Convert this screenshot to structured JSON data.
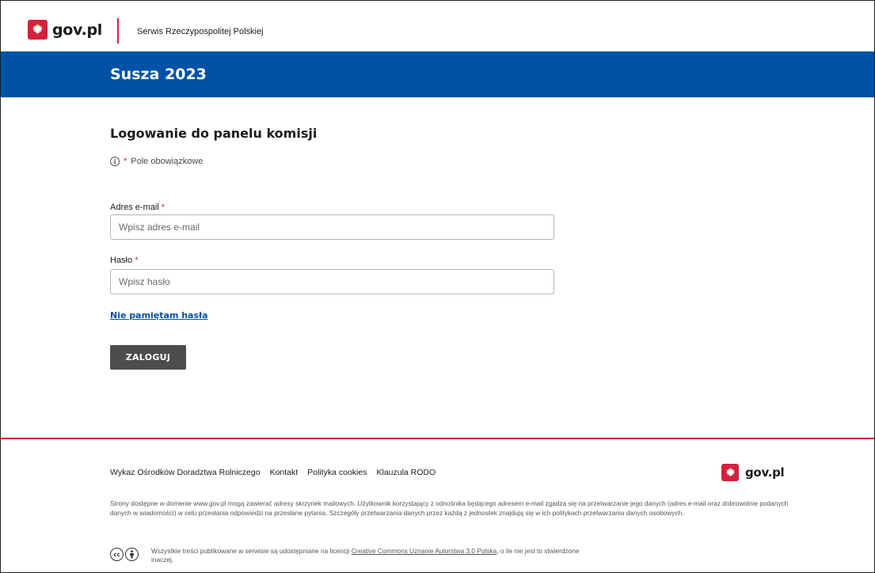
{
  "header": {
    "logo_text": "gov.pl",
    "service_name": "Serwis Rzeczypospolitej Polskiej"
  },
  "banner": {
    "title": "Susza 2023"
  },
  "main": {
    "title": "Logowanie do panelu komisji",
    "required_marker": "*",
    "required_note": "Pole obowiązkowe",
    "email": {
      "label": "Adres e-mail",
      "placeholder": "Wpisz adres e-mail",
      "value": ""
    },
    "password": {
      "label": "Hasło",
      "placeholder": "Wpisz hasło",
      "value": ""
    },
    "forgot_link": "Nie pamiętam hasła",
    "login_button": "ZALOGUJ"
  },
  "footer": {
    "links": [
      "Wykaz Ośrodków Doradztwa Rolniczego",
      "Kontakt",
      "Polityka cookies",
      "Klauzula RODO"
    ],
    "logo_text": "gov.pl",
    "disclaimer": "Strony dostępne w domenie www.gov.pl mogą zawierać adresy skrzynek mailowych. Użytkownik korzystający z odnośnika będącego adresem e-mail zgadza się na przetwarzanie jego danych (adres e-mail oraz dobrowolnie podanych danych w wiadomości) w celu przesłania odpowiedzi na przesłane pytania. Szczegóły przetwarzania danych przez każdą z jednostek znajdują się w ich politykach przetwarzania danych osobowych.",
    "license_prefix": "Wszystkie treści publikowane w serwisie są udostępniane na licencji ",
    "license_link": "Creative Commons Uznanie Autorstwa 3.0 Polska",
    "license_suffix": ", o ile nie jest to stwierdzone inaczej.",
    "cc_icons": [
      "cc-icon",
      "attribution-icon"
    ]
  },
  "colors": {
    "brand_blue": "#0052a5",
    "brand_red": "#d4213d",
    "button_gray": "#4d4d4d"
  }
}
